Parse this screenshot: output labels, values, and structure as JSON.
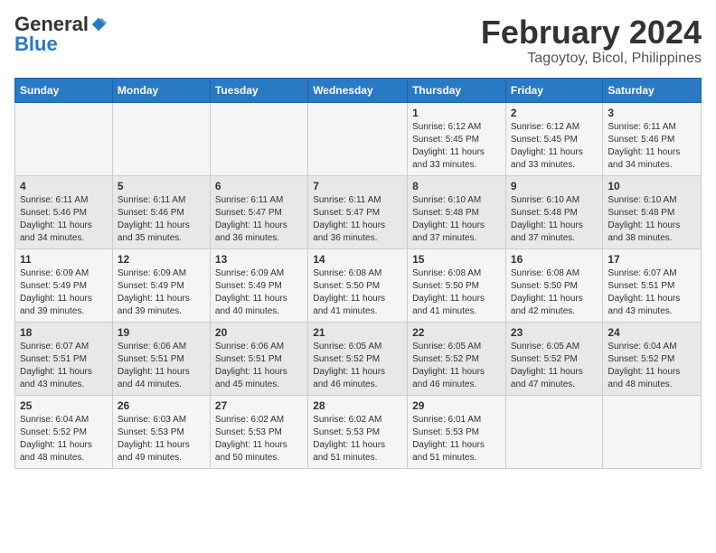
{
  "logo": {
    "general": "General",
    "blue": "Blue"
  },
  "title": {
    "month_year": "February 2024",
    "location": "Tagoytoy, Bicol, Philippines"
  },
  "days_of_week": [
    "Sunday",
    "Monday",
    "Tuesday",
    "Wednesday",
    "Thursday",
    "Friday",
    "Saturday"
  ],
  "weeks": [
    [
      {
        "day": "",
        "sunrise": "",
        "sunset": "",
        "daylight": ""
      },
      {
        "day": "",
        "sunrise": "",
        "sunset": "",
        "daylight": ""
      },
      {
        "day": "",
        "sunrise": "",
        "sunset": "",
        "daylight": ""
      },
      {
        "day": "",
        "sunrise": "",
        "sunset": "",
        "daylight": ""
      },
      {
        "day": "1",
        "sunrise": "Sunrise: 6:12 AM",
        "sunset": "Sunset: 5:45 PM",
        "daylight": "Daylight: 11 hours and 33 minutes."
      },
      {
        "day": "2",
        "sunrise": "Sunrise: 6:12 AM",
        "sunset": "Sunset: 5:45 PM",
        "daylight": "Daylight: 11 hours and 33 minutes."
      },
      {
        "day": "3",
        "sunrise": "Sunrise: 6:11 AM",
        "sunset": "Sunset: 5:46 PM",
        "daylight": "Daylight: 11 hours and 34 minutes."
      }
    ],
    [
      {
        "day": "4",
        "sunrise": "Sunrise: 6:11 AM",
        "sunset": "Sunset: 5:46 PM",
        "daylight": "Daylight: 11 hours and 34 minutes."
      },
      {
        "day": "5",
        "sunrise": "Sunrise: 6:11 AM",
        "sunset": "Sunset: 5:46 PM",
        "daylight": "Daylight: 11 hours and 35 minutes."
      },
      {
        "day": "6",
        "sunrise": "Sunrise: 6:11 AM",
        "sunset": "Sunset: 5:47 PM",
        "daylight": "Daylight: 11 hours and 36 minutes."
      },
      {
        "day": "7",
        "sunrise": "Sunrise: 6:11 AM",
        "sunset": "Sunset: 5:47 PM",
        "daylight": "Daylight: 11 hours and 36 minutes."
      },
      {
        "day": "8",
        "sunrise": "Sunrise: 6:10 AM",
        "sunset": "Sunset: 5:48 PM",
        "daylight": "Daylight: 11 hours and 37 minutes."
      },
      {
        "day": "9",
        "sunrise": "Sunrise: 6:10 AM",
        "sunset": "Sunset: 5:48 PM",
        "daylight": "Daylight: 11 hours and 37 minutes."
      },
      {
        "day": "10",
        "sunrise": "Sunrise: 6:10 AM",
        "sunset": "Sunset: 5:48 PM",
        "daylight": "Daylight: 11 hours and 38 minutes."
      }
    ],
    [
      {
        "day": "11",
        "sunrise": "Sunrise: 6:09 AM",
        "sunset": "Sunset: 5:49 PM",
        "daylight": "Daylight: 11 hours and 39 minutes."
      },
      {
        "day": "12",
        "sunrise": "Sunrise: 6:09 AM",
        "sunset": "Sunset: 5:49 PM",
        "daylight": "Daylight: 11 hours and 39 minutes."
      },
      {
        "day": "13",
        "sunrise": "Sunrise: 6:09 AM",
        "sunset": "Sunset: 5:49 PM",
        "daylight": "Daylight: 11 hours and 40 minutes."
      },
      {
        "day": "14",
        "sunrise": "Sunrise: 6:08 AM",
        "sunset": "Sunset: 5:50 PM",
        "daylight": "Daylight: 11 hours and 41 minutes."
      },
      {
        "day": "15",
        "sunrise": "Sunrise: 6:08 AM",
        "sunset": "Sunset: 5:50 PM",
        "daylight": "Daylight: 11 hours and 41 minutes."
      },
      {
        "day": "16",
        "sunrise": "Sunrise: 6:08 AM",
        "sunset": "Sunset: 5:50 PM",
        "daylight": "Daylight: 11 hours and 42 minutes."
      },
      {
        "day": "17",
        "sunrise": "Sunrise: 6:07 AM",
        "sunset": "Sunset: 5:51 PM",
        "daylight": "Daylight: 11 hours and 43 minutes."
      }
    ],
    [
      {
        "day": "18",
        "sunrise": "Sunrise: 6:07 AM",
        "sunset": "Sunset: 5:51 PM",
        "daylight": "Daylight: 11 hours and 43 minutes."
      },
      {
        "day": "19",
        "sunrise": "Sunrise: 6:06 AM",
        "sunset": "Sunset: 5:51 PM",
        "daylight": "Daylight: 11 hours and 44 minutes."
      },
      {
        "day": "20",
        "sunrise": "Sunrise: 6:06 AM",
        "sunset": "Sunset: 5:51 PM",
        "daylight": "Daylight: 11 hours and 45 minutes."
      },
      {
        "day": "21",
        "sunrise": "Sunrise: 6:05 AM",
        "sunset": "Sunset: 5:52 PM",
        "daylight": "Daylight: 11 hours and 46 minutes."
      },
      {
        "day": "22",
        "sunrise": "Sunrise: 6:05 AM",
        "sunset": "Sunset: 5:52 PM",
        "daylight": "Daylight: 11 hours and 46 minutes."
      },
      {
        "day": "23",
        "sunrise": "Sunrise: 6:05 AM",
        "sunset": "Sunset: 5:52 PM",
        "daylight": "Daylight: 11 hours and 47 minutes."
      },
      {
        "day": "24",
        "sunrise": "Sunrise: 6:04 AM",
        "sunset": "Sunset: 5:52 PM",
        "daylight": "Daylight: 11 hours and 48 minutes."
      }
    ],
    [
      {
        "day": "25",
        "sunrise": "Sunrise: 6:04 AM",
        "sunset": "Sunset: 5:52 PM",
        "daylight": "Daylight: 11 hours and 48 minutes."
      },
      {
        "day": "26",
        "sunrise": "Sunrise: 6:03 AM",
        "sunset": "Sunset: 5:53 PM",
        "daylight": "Daylight: 11 hours and 49 minutes."
      },
      {
        "day": "27",
        "sunrise": "Sunrise: 6:02 AM",
        "sunset": "Sunset: 5:53 PM",
        "daylight": "Daylight: 11 hours and 50 minutes."
      },
      {
        "day": "28",
        "sunrise": "Sunrise: 6:02 AM",
        "sunset": "Sunset: 5:53 PM",
        "daylight": "Daylight: 11 hours and 51 minutes."
      },
      {
        "day": "29",
        "sunrise": "Sunrise: 6:01 AM",
        "sunset": "Sunset: 5:53 PM",
        "daylight": "Daylight: 11 hours and 51 minutes."
      },
      {
        "day": "",
        "sunrise": "",
        "sunset": "",
        "daylight": ""
      },
      {
        "day": "",
        "sunrise": "",
        "sunset": "",
        "daylight": ""
      }
    ]
  ]
}
